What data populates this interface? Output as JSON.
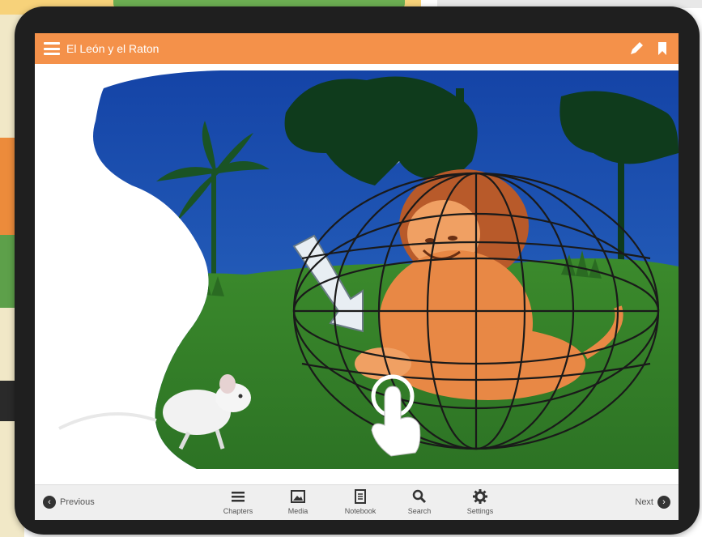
{
  "app": {
    "title": "El León y el Raton"
  },
  "toolbar": {
    "items": [
      {
        "label": "Chapters",
        "icon": "list-icon"
      },
      {
        "label": "Media",
        "icon": "image-icon"
      },
      {
        "label": "Notebook",
        "icon": "notebook-icon"
      },
      {
        "label": "Search",
        "icon": "search-icon"
      },
      {
        "label": "Settings",
        "icon": "gear-icon"
      }
    ]
  },
  "nav": {
    "previous": "Previous",
    "next": "Next"
  },
  "colors": {
    "header": "#f4914a",
    "toolbar": "#efefef",
    "night_sky": "#1d4aa3",
    "grass": "#3c8a2c"
  }
}
